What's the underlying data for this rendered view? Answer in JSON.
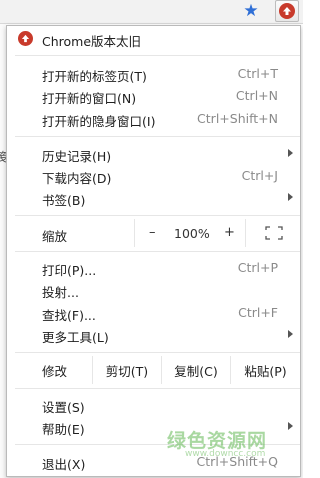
{
  "menu": {
    "update_label": "Chrome版本太旧",
    "items_group1": [
      {
        "label": "打开新的标签页(T)",
        "shortcut": "Ctrl+T"
      },
      {
        "label": "打开新的窗口(N)",
        "shortcut": "Ctrl+N"
      },
      {
        "label": "打开新的隐身窗口(I)",
        "shortcut": "Ctrl+Shift+N"
      }
    ],
    "items_group2": [
      {
        "label": "历史记录(H)",
        "shortcut": ""
      },
      {
        "label": "下载内容(D)",
        "shortcut": "Ctrl+J"
      },
      {
        "label": "书签(B)",
        "shortcut": ""
      }
    ],
    "zoom": {
      "label": "缩放",
      "minus": "–",
      "value": "100%",
      "plus": "+"
    },
    "items_group3": [
      {
        "label": "打印(P)...",
        "shortcut": "Ctrl+P"
      },
      {
        "label": "投射...",
        "shortcut": ""
      },
      {
        "label": "查找(F)...",
        "shortcut": "Ctrl+F"
      },
      {
        "label": "更多工具(L)",
        "shortcut": ""
      }
    ],
    "edit": {
      "label": "修改",
      "cut": "剪切(T)",
      "copy": "复制(C)",
      "paste": "粘贴(P)"
    },
    "items_group4": [
      {
        "label": "设置(S)",
        "shortcut": ""
      },
      {
        "label": "帮助(E)",
        "shortcut": ""
      }
    ],
    "exit": {
      "label": "退出(X)",
      "shortcut": "Ctrl+Shift+Q"
    }
  },
  "background": {
    "left_char": "笺"
  },
  "watermark": {
    "text": "绿色资源网",
    "sub": "www.downcc.com"
  },
  "colors": {
    "update_red": "#c83a2b",
    "star_blue": "#2f6fd6"
  }
}
